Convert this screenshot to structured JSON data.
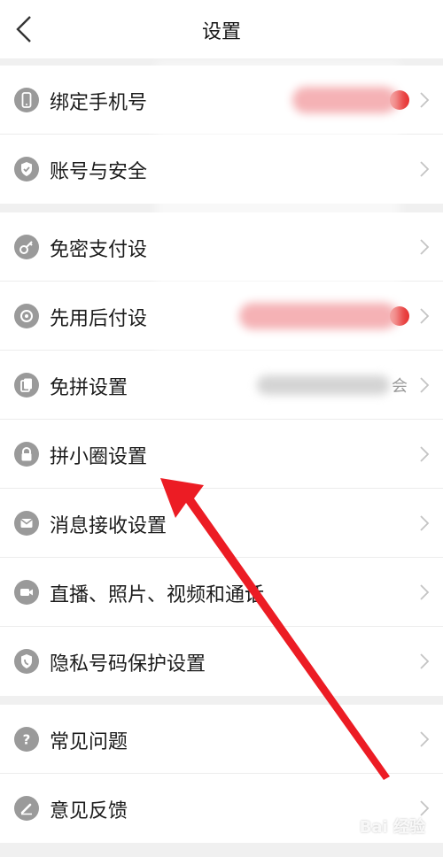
{
  "header": {
    "title": "设置"
  },
  "groups": [
    {
      "items": [
        {
          "label": "绑定手机号"
        },
        {
          "label": "账号与安全"
        }
      ]
    },
    {
      "items": [
        {
          "label": "免密支付设"
        },
        {
          "label": "先用后付设"
        },
        {
          "label": "免拼设置",
          "value_tail": "会"
        },
        {
          "label": "拼小圈设置"
        },
        {
          "label": "消息接收设置"
        },
        {
          "label": "直播、照片、视频和通话"
        },
        {
          "label": "隐私号码保护设置"
        }
      ]
    },
    {
      "items": [
        {
          "label": "常见问题"
        },
        {
          "label": "意见反馈"
        }
      ]
    }
  ],
  "watermark": {
    "text": "Bai 经验"
  },
  "colors": {
    "accent_red": "#e73332",
    "arrow_red": "#ec1c24",
    "icon_gray": "#9a9a9a"
  }
}
